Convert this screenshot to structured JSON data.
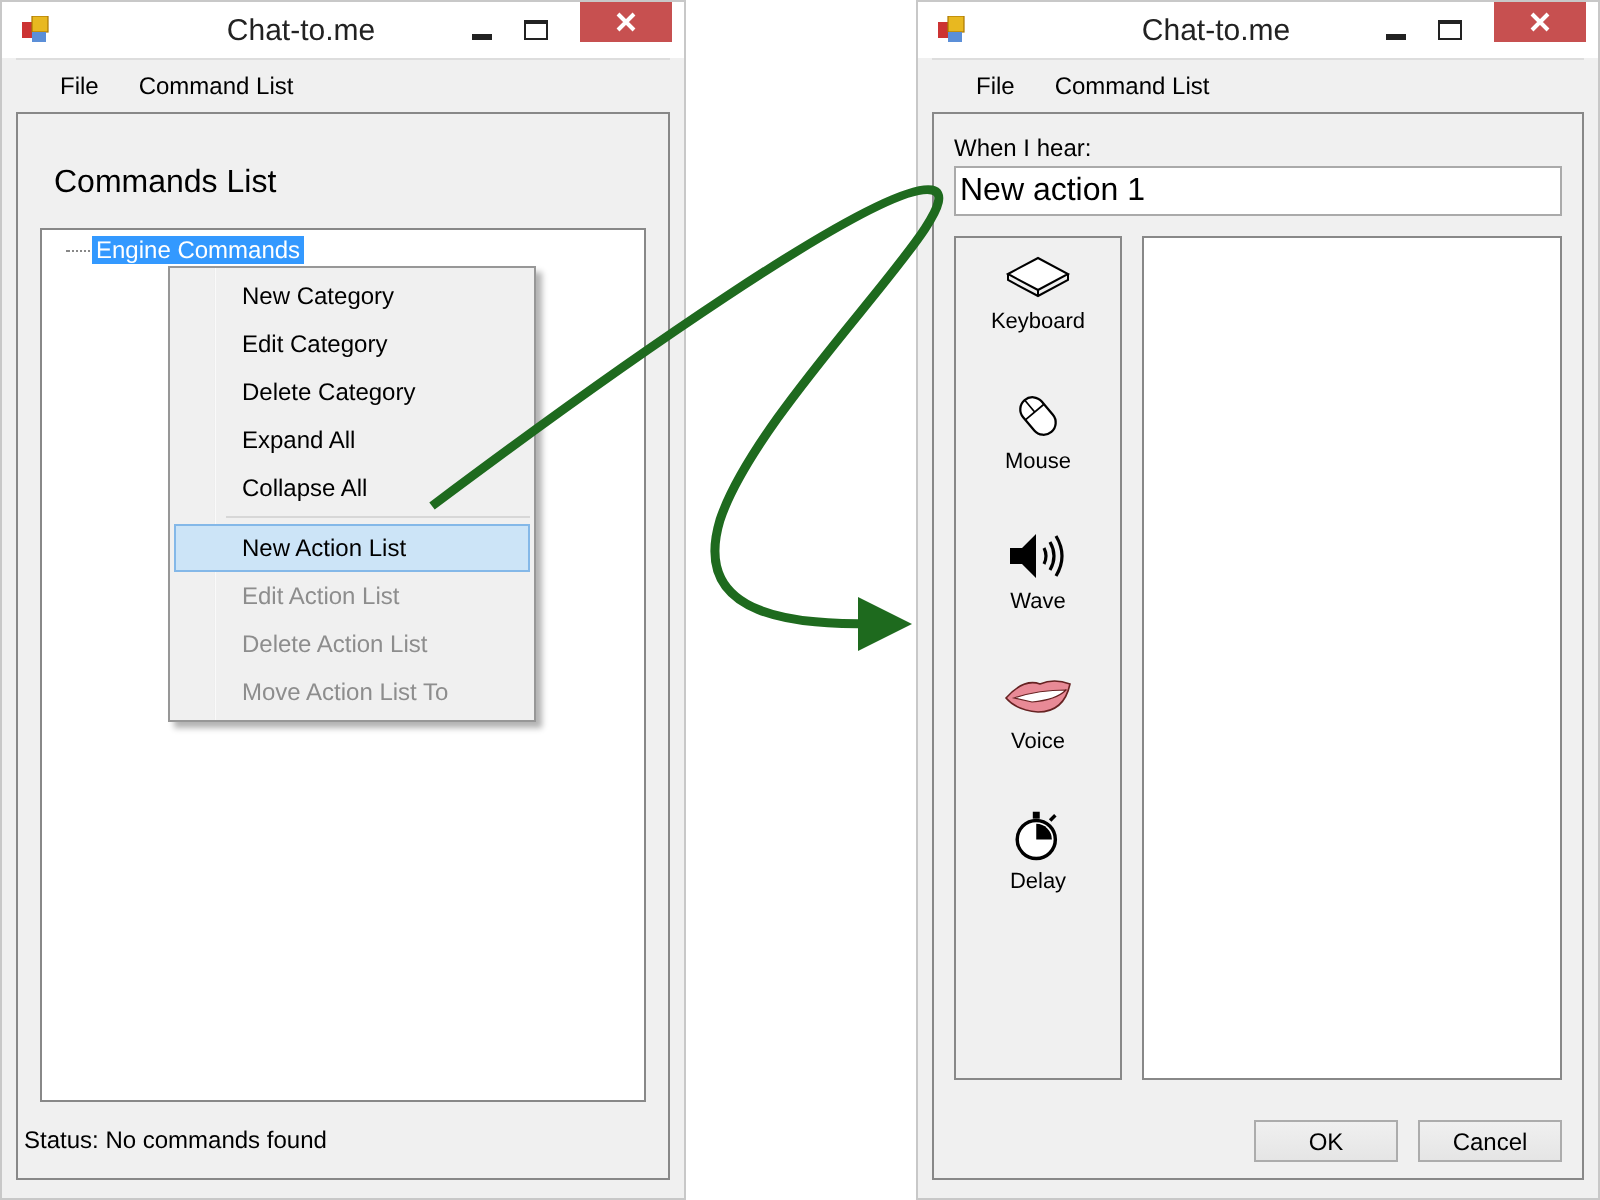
{
  "commands_window": {
    "title": "Chat-to.me",
    "menu": [
      "File",
      "Command List"
    ],
    "heading": "Commands List",
    "tree": [
      {
        "label": "Engine Commands",
        "selected": true
      }
    ],
    "context_menu": [
      {
        "kind": "item",
        "label": "New Category",
        "disabled": false,
        "selected": false
      },
      {
        "kind": "item",
        "label": "Edit Category",
        "disabled": false,
        "selected": false
      },
      {
        "kind": "item",
        "label": "Delete Category",
        "disabled": false,
        "selected": false
      },
      {
        "kind": "item",
        "label": "Expand All",
        "disabled": false,
        "selected": false
      },
      {
        "kind": "item",
        "label": "Collapse All",
        "disabled": false,
        "selected": false
      },
      {
        "kind": "separator"
      },
      {
        "kind": "item",
        "label": "New Action List",
        "disabled": false,
        "selected": true
      },
      {
        "kind": "item",
        "label": "Edit Action List",
        "disabled": true,
        "selected": false
      },
      {
        "kind": "item",
        "label": "Delete Action List",
        "disabled": true,
        "selected": false
      },
      {
        "kind": "item",
        "label": "Move Action List To",
        "disabled": true,
        "selected": false
      }
    ],
    "status": "Status: No commands found"
  },
  "action_window": {
    "title": "Chat-to.me",
    "menu": [
      "File",
      "Command List"
    ],
    "field_label": "When I hear:",
    "field_value": "New action 1",
    "toolbox": [
      {
        "kind": "keyboard",
        "label": "Keyboard"
      },
      {
        "kind": "mouse",
        "label": "Mouse"
      },
      {
        "kind": "wave",
        "label": "Wave"
      },
      {
        "kind": "voice",
        "label": "Voice"
      },
      {
        "kind": "delay",
        "label": "Delay"
      }
    ],
    "buttons": [
      "OK",
      "Cancel"
    ]
  }
}
